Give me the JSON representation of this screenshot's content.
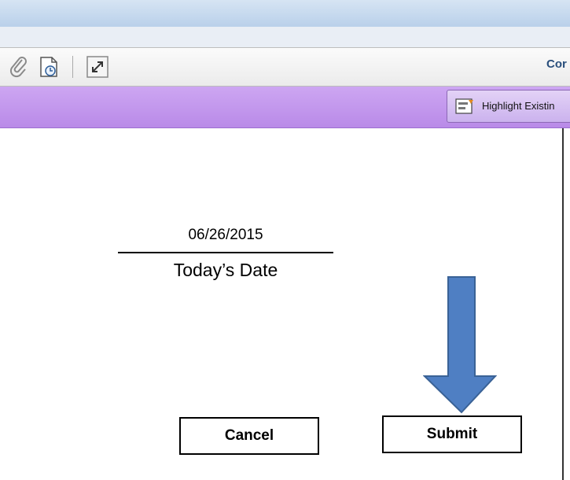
{
  "toolbar": {
    "icons": [
      "attach-icon",
      "clock-page-icon",
      "expand-icon"
    ],
    "comment_link": "Cor"
  },
  "form_bar": {
    "highlight_button_label": "Highlight Existin"
  },
  "document": {
    "date_value": "06/26/2015",
    "date_label": "Today’s Date"
  },
  "buttons": {
    "cancel_label": "Cancel",
    "submit_label": "Submit"
  },
  "colors": {
    "form_bar": "#c79ff0",
    "arrow_fill": "#4f7fc3",
    "arrow_stroke": "#3a6296"
  }
}
